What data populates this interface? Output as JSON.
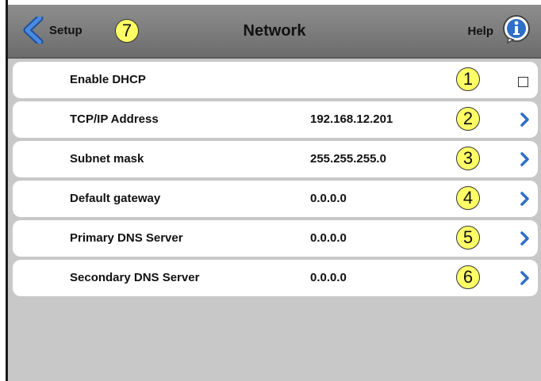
{
  "header": {
    "back_label": "Setup",
    "back_callout": "7",
    "title": "Network",
    "help_label": "Help"
  },
  "rows": [
    {
      "label": "Enable DHCP",
      "value": "",
      "callout": "1",
      "control": "checkbox",
      "checked": false
    },
    {
      "label": "TCP/IP Address",
      "value": "192.168.12.201",
      "callout": "2",
      "control": "chevron"
    },
    {
      "label": "Subnet mask",
      "value": "255.255.255.0",
      "callout": "3",
      "control": "chevron"
    },
    {
      "label": "Default gateway",
      "value": "0.0.0.0",
      "callout": "4",
      "control": "chevron"
    },
    {
      "label": "Primary DNS Server",
      "value": "0.0.0.0",
      "callout": "5",
      "control": "chevron"
    },
    {
      "label": "Secondary DNS Server",
      "value": "0.0.0.0",
      "callout": "6",
      "control": "chevron"
    }
  ],
  "colors": {
    "accent": "#2e6fc7",
    "callout_fill": "#ffff66",
    "header_bg": "#7d7d7d",
    "page_bg": "#c8c8c8"
  },
  "icons": {
    "back": "chevron-left-icon",
    "help": "info-icon",
    "row_arrow": "chevron-right-icon"
  }
}
